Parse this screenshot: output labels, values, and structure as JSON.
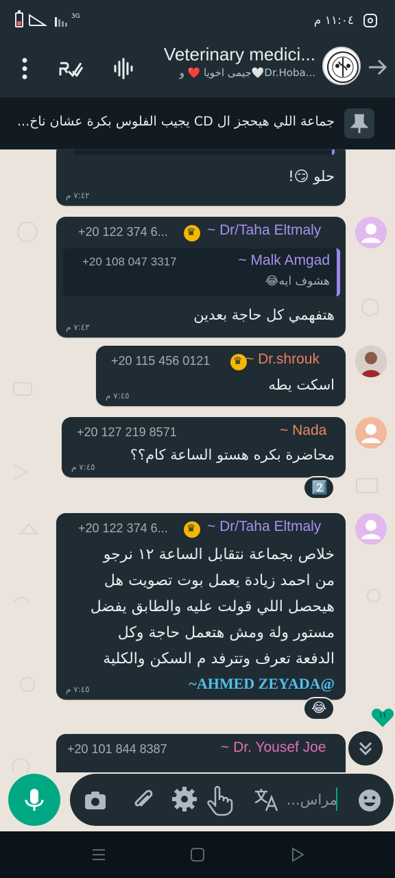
{
  "status_bar": {
    "time": "١١:٠٤ م",
    "network": "3G",
    "icons": [
      "battery-icon",
      "signal-icon",
      "instagram-icon"
    ]
  },
  "header": {
    "title": "Veterinary medici...",
    "subtitle": "جيمى اخويا ❤️ و🤍Dr.Hoba...",
    "icons": [
      "back-arrow-icon",
      "group-avatar",
      "voice-wave-icon",
      "check-icon",
      "more-vert-icon"
    ]
  },
  "pinned": {
    "text": "جماعة اللي هيحجز ال CD يجيب الفلوس بكرة عشان ناخ..."
  },
  "messages": [
    {
      "id": "m0",
      "text": "حلو 😏!",
      "quote_partial": "...",
      "time": "٧:٤٢ م"
    },
    {
      "id": "m1",
      "sender": "~ Dr/Taha Eltmaly",
      "phone": "+20 122 374 6...",
      "sender_color": "#a791f0",
      "quote": {
        "sender": "~ Malk Amgad",
        "phone": "+20 108 047 3317",
        "text": "هشوف ايه😂"
      },
      "text": "هتفهمي كل حاجة بعدين",
      "time": "٧:٤٣ م"
    },
    {
      "id": "m2",
      "sender": "~ Dr.shrouk",
      "phone": "+20 115 456 0121",
      "sender_color": "#ef7e61",
      "text": "اسكت يطه",
      "time": "٧:٤٥ م"
    },
    {
      "id": "m3",
      "sender": "~ Nada",
      "phone": "+20 127 219 8571",
      "sender_color": "#e6895f",
      "text": "محاضرة بكره هستو الساعة كام؟؟",
      "time": "٧:٤٥ م",
      "reaction": "2️⃣"
    },
    {
      "id": "m4",
      "sender": "~ Dr/Taha Eltmaly",
      "phone": "+20 122 374 6...",
      "sender_color": "#a791f0",
      "lines": [
        "خلاص بجماعة نتقابل الساعة ١٢ نرجو",
        "من احمد زيادة يعمل بوت تصويت هل",
        "هيحصل اللي قولت عليه والطابق يفضل",
        "مستور ولة ومش هتعمل حاجة وكل",
        "الدفعة تعرف وتترفد م السكن والكلية"
      ],
      "mention": "~AHMED ZEYADA@",
      "time": "٧:٤٥ م",
      "reaction": "😂"
    },
    {
      "id": "m5",
      "sender": "~ Dr. Yousef Joe",
      "phone": "+20 101 844 8387",
      "sender_color": "#e070b4"
    }
  ],
  "unread_count": "١١",
  "input": {
    "placeholder": "مراس...",
    "icons": [
      "emoji-icon",
      "translate-icon",
      "touch-icon",
      "settings-icon",
      "attach-icon",
      "camera-icon",
      "mic-icon"
    ]
  },
  "nav": [
    "menu-icon",
    "home-icon",
    "back-icon"
  ],
  "colors": {
    "accent": "#00a884",
    "bubble": "#1f2c34",
    "header": "#1f2c34",
    "wallpaper": "#ebe4dc"
  }
}
